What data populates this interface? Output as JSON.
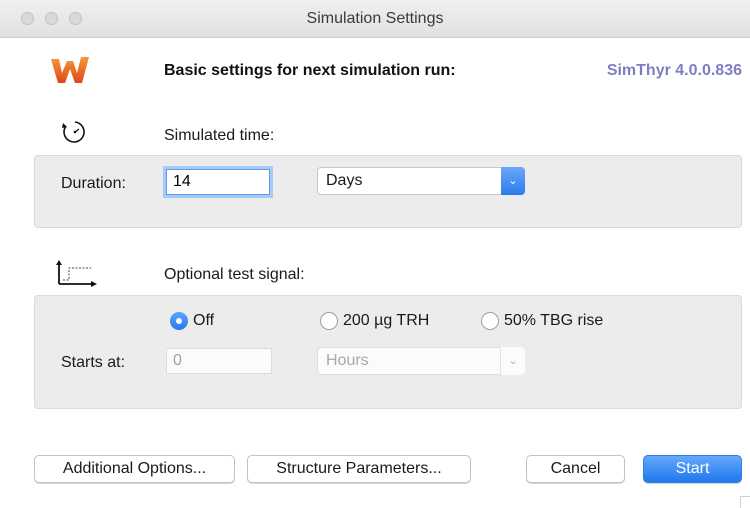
{
  "window": {
    "title": "Simulation Settings"
  },
  "header": {
    "heading": "Basic settings for next simulation run:",
    "version": "SimThyr 4.0.0.836"
  },
  "simulated_time": {
    "label": "Simulated time:",
    "duration_label": "Duration:",
    "duration_value": "14",
    "unit_selected": "Days"
  },
  "test_signal": {
    "label": "Optional test signal:",
    "options": [
      {
        "label": "Off",
        "selected": true
      },
      {
        "label": "200 µg TRH",
        "selected": false
      },
      {
        "label": "50% TBG rise",
        "selected": false
      }
    ],
    "starts_at_label": "Starts at:",
    "starts_at_value": "0",
    "starts_unit_selected": "Hours"
  },
  "buttons": {
    "additional_options": "Additional Options...",
    "structure_parameters": "Structure Parameters...",
    "cancel": "Cancel",
    "start": "Start"
  },
  "colors": {
    "accent": "#2a7cf0",
    "version_text": "#7e7ec4",
    "logo_orange": "#f07a1c"
  },
  "icons": {
    "app_logo": "simthyr-logo-icon",
    "time": "clock-icon",
    "signal": "step-signal-icon"
  }
}
